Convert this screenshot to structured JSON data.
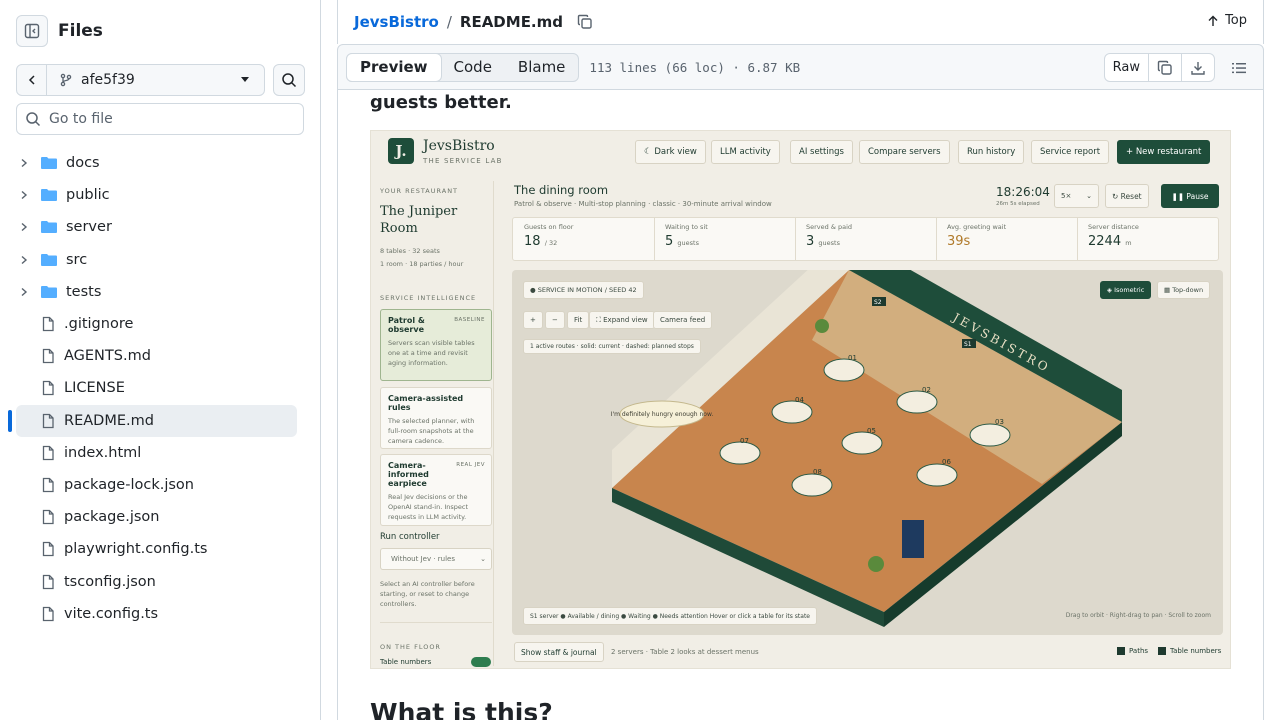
{
  "sidebar": {
    "title": "Files",
    "branch": "afe5f39",
    "search_placeholder": "Go to file",
    "items": [
      {
        "type": "folder",
        "label": "docs"
      },
      {
        "type": "folder",
        "label": "public"
      },
      {
        "type": "folder",
        "label": "server"
      },
      {
        "type": "folder",
        "label": "src"
      },
      {
        "type": "folder",
        "label": "tests"
      },
      {
        "type": "file",
        "label": ".gitignore"
      },
      {
        "type": "file",
        "label": "AGENTS.md"
      },
      {
        "type": "file",
        "label": "LICENSE"
      },
      {
        "type": "file",
        "label": "README.md",
        "active": true
      },
      {
        "type": "file",
        "label": "index.html"
      },
      {
        "type": "file",
        "label": "package-lock.json"
      },
      {
        "type": "file",
        "label": "package.json"
      },
      {
        "type": "file",
        "label": "playwright.config.ts"
      },
      {
        "type": "file",
        "label": "tsconfig.json"
      },
      {
        "type": "file",
        "label": "vite.config.ts"
      }
    ]
  },
  "header": {
    "repo": "JevsBistro",
    "separator": "/",
    "file": "README.md",
    "top_label": "Top"
  },
  "filebar": {
    "tabs": [
      "Preview",
      "Code",
      "Blame"
    ],
    "active_tab": "Preview",
    "meta": "113 lines (66 loc) · 6.87 KB",
    "raw_label": "Raw"
  },
  "readme": {
    "partial_heading": "guests better.",
    "heading2": "What is this?"
  },
  "screenshot": {
    "brand": "JevsBistro",
    "brand_sub": "THE SERVICE LAB",
    "logo": "J.",
    "top_buttons": [
      "☾ Dark view",
      "LLM activity",
      "AI settings",
      "Compare servers",
      "Run history",
      "Service report",
      "+ New restaurant"
    ],
    "your_restaurant_label": "YOUR RESTAURANT",
    "restaurant_name": "The Juniper Room",
    "restaurant_meta1": "8 tables · 32 seats",
    "restaurant_meta2": "1 room · 18 parties / hour",
    "service_intel_label": "SERVICE INTELLIGENCE",
    "cards": [
      {
        "title": "Patrol & observe",
        "tag": "BASELINE",
        "desc": "Servers scan visible tables one at a time and revisit aging information."
      },
      {
        "title": "Camera-assisted rules",
        "tag": "",
        "desc": "The selected planner, with full-room snapshots at the camera cadence."
      },
      {
        "title": "Camera-informed earpiece",
        "tag": "REAL JEV",
        "desc": "Real Jev decisions or the OpenAI stand-in. Inspect requests in LLM activity."
      }
    ],
    "run_controller_label": "Run controller",
    "run_controller_value": "Without Jev · rules",
    "run_controller_hint": "Select an AI controller before starting, or reset to change controllers.",
    "on_floor_label": "ON THE FLOOR",
    "table_numbers_label": "Table numbers",
    "room_title": "The dining room",
    "room_sub": "Patrol & observe · Multi-stop planning · classic · 30-minute arrival window",
    "clock": "18:26:04",
    "clock_sub": "26m 5s elapsed",
    "speed": "5×",
    "reset_label": "↻ Reset",
    "pause_label": "❚❚ Pause",
    "stats": [
      {
        "label": "Guests on floor",
        "value": "18",
        "unit": "/ 32"
      },
      {
        "label": "Waiting to sit",
        "value": "5",
        "unit": "guests"
      },
      {
        "label": "Served & paid",
        "value": "3",
        "unit": "guests"
      },
      {
        "label": "Avg. greeting wait",
        "value": "39s",
        "unit": ""
      },
      {
        "label": "Server distance",
        "value": "2244",
        "unit": "m"
      }
    ],
    "status_pill": "● SERVICE IN MOTION  /  SEED 42",
    "view_isometric": "◈ Isometric",
    "view_topdown": "▦ Top-down",
    "zoom_plus": "+",
    "zoom_minus": "−",
    "fit": "Fit",
    "expand": "⛶ Expand view",
    "camera_feed": "Camera feed",
    "routes_note": "1 active routes · solid: current · dashed: planned stops",
    "speech": "I'm definitely hungry enough now.",
    "wall_sign": "JEVSBISTRO",
    "legend": "S1 server  ● Available / dining  ● Waiting  ● Needs attention   Hover or click a table for its state",
    "hint": "Drag to orbit · Right-drag to pan · Scroll to zoom",
    "show_staff": "Show staff & journal",
    "journal_note": "2 servers · Table 2 looks at dessert menus",
    "paths_label": "Paths",
    "table_numbers_check": "Table numbers",
    "table_labels": [
      "01",
      "02",
      "03",
      "04",
      "05",
      "06",
      "07",
      "08"
    ],
    "server_tags": [
      "S2",
      "S1"
    ]
  },
  "colors": {
    "link": "#0969da",
    "accent_green": "#1e4d3a",
    "folder": "#54aeff",
    "active_bar": "#0969da"
  }
}
